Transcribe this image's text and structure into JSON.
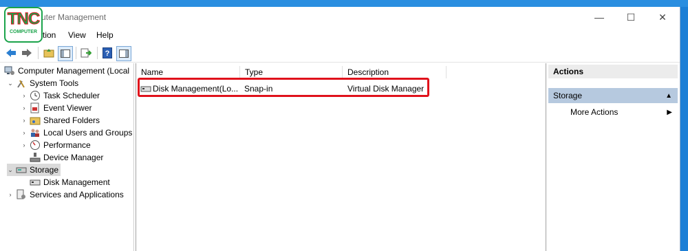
{
  "window": {
    "title": "uter Management",
    "controls": {
      "minimize": "—",
      "maximize": "☐",
      "close": "✕"
    }
  },
  "logo": {
    "main": "TNC",
    "sub": "COMPUTER"
  },
  "menubar": {
    "items": [
      "tion",
      "View",
      "Help"
    ]
  },
  "toolbar": {
    "icons": [
      "back-icon",
      "forward-icon",
      "up-folder-icon",
      "show-hide-tree-icon",
      "export-list-icon",
      "help-icon",
      "show-hide-action-pane-icon"
    ]
  },
  "tree": {
    "items": [
      {
        "label": "Computer Management (Local",
        "icon": "computer-management-icon",
        "expander": ""
      },
      {
        "label": "System Tools",
        "icon": "system-tools-icon",
        "expander": "⌄"
      },
      {
        "label": "Task Scheduler",
        "icon": "task-scheduler-icon",
        "expander": "›"
      },
      {
        "label": "Event Viewer",
        "icon": "event-viewer-icon",
        "expander": "›"
      },
      {
        "label": "Shared Folders",
        "icon": "shared-folders-icon",
        "expander": "›"
      },
      {
        "label": "Local Users and Groups",
        "icon": "local-users-icon",
        "expander": "›"
      },
      {
        "label": "Performance",
        "icon": "performance-icon",
        "expander": "›"
      },
      {
        "label": "Device Manager",
        "icon": "device-manager-icon",
        "expander": ""
      },
      {
        "label": "Storage",
        "icon": "storage-icon",
        "expander": "⌄",
        "selected": true
      },
      {
        "label": "Disk Management",
        "icon": "disk-management-icon",
        "expander": ""
      },
      {
        "label": "Services and Applications",
        "icon": "services-icon",
        "expander": "›"
      }
    ]
  },
  "list": {
    "columns": [
      "Name",
      "Type",
      "Description"
    ],
    "rows": [
      {
        "name": "Disk Management(Lo...",
        "type": "Snap-in",
        "description": "Virtual Disk Manager"
      }
    ]
  },
  "actions": {
    "header": "Actions",
    "section": "Storage",
    "section_arrow": "▲",
    "item": "More Actions",
    "item_arrow": "▶"
  },
  "colors": {
    "highlight": "#e0111b",
    "logo": "#1aa34a",
    "section": "#b6c9df"
  }
}
